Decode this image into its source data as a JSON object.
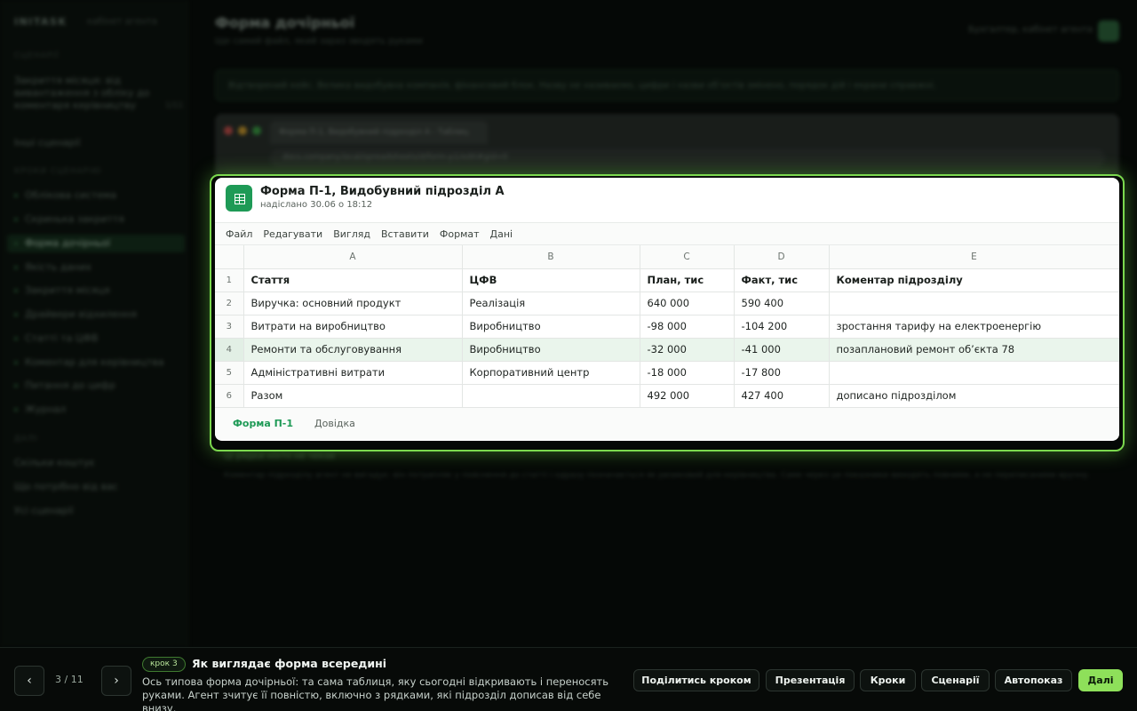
{
  "app": {
    "logo": "INITASK",
    "logo_sub": "кабінет агента",
    "page_title": "Форма дочірньої",
    "page_subtitle": "Ще самий файл, який зараз зводять руками",
    "top_right": "Бухгалтер, кабінет агента",
    "avatar": "Б",
    "banner": "Відтворений кейс. Велика видобувна компанія, фінансовий блок. Назву не називаємо, цифри і назви об’єктів змінено, порядок дій і екрани справжні.",
    "window_tab": "Форма П-1, Видобувний підрозділ А - Таблиц",
    "window_url": "docs.company.local/spreadsheets/d/form-p1/edit#gid=0",
    "caption_title": "Ці рядки ніхто не чекав",
    "caption_text": "Коментар підрозділу агент не вигадує: він потрапляє у пояснення до статті і одразу позначається як ризиковий для керівництва. Саме через це показники виходять повними, а не переписаними вручну."
  },
  "sidebar": {
    "section_1": "СЦЕНАРІЇ",
    "scenario_items": [
      {
        "label": "Закриття місяця: від вивантаження з обліку до коментаря керівництву",
        "badge": "1/11"
      },
      {
        "label": "Інші сценарії"
      }
    ],
    "section_2": "КРОКИ СЦЕНАРІЮ",
    "step_items": [
      {
        "label": "Облікова система"
      },
      {
        "label": "Скринька закриття"
      },
      {
        "label": "Форма дочірньої"
      },
      {
        "label": "Якість даних"
      },
      {
        "label": "Закриття місяця"
      },
      {
        "label": "Драйвери відхилення"
      },
      {
        "label": "Статті та ЦФВ"
      },
      {
        "label": "Коментар для керівництва"
      },
      {
        "label": "Питання до цифр"
      },
      {
        "label": "Журнал"
      }
    ],
    "section_3": "ДАЛІ",
    "next_items": [
      {
        "label": "Скільки коштує"
      },
      {
        "label": "Що потрібно від вас"
      },
      {
        "label": "Усі сценарії"
      }
    ]
  },
  "document": {
    "title": "Форма П-1, Видобувний підрозділ А",
    "meta": "надіслано 30.06 о 18:12",
    "menu": [
      "Файл",
      "Редагувати",
      "Вигляд",
      "Вставити",
      "Формат",
      "Дані"
    ],
    "columns": [
      "A",
      "B",
      "C",
      "D",
      "E"
    ],
    "rows": [
      {
        "n": "1",
        "cells": [
          "Стаття",
          "ЦФВ",
          "План, тис",
          "Факт, тис",
          "Коментар підрозділу"
        ]
      },
      {
        "n": "2",
        "cells": [
          "Виручка: основний продукт",
          "Реалізація",
          "640 000",
          "590 400",
          ""
        ]
      },
      {
        "n": "3",
        "cells": [
          "Витрати на виробництво",
          "Виробництво",
          "-98 000",
          "-104 200",
          "зростання тарифу на електроенергію"
        ]
      },
      {
        "n": "4",
        "cells": [
          "Ремонти та обслуговування",
          "Виробництво",
          "-32 000",
          "-41 000",
          "позаплановий ремонт об’єкта 78"
        ]
      },
      {
        "n": "5",
        "cells": [
          "Адміністративні витрати",
          "Корпоративний центр",
          "-18 000",
          "-17 800",
          ""
        ]
      },
      {
        "n": "6",
        "cells": [
          "Разом",
          "",
          "492 000",
          "427 400",
          "дописано підрозділом"
        ]
      }
    ],
    "tabs": [
      "Форма П-1",
      "Довідка"
    ]
  },
  "bottom": {
    "prev": "‹",
    "next": "›",
    "counter": "3 / 11",
    "step_badge": "крок 3",
    "step_title": "Як виглядає форма всередині",
    "step_desc": "Ось типова форма дочірньої: та сама таблиця, яку сьогодні відкривають і переносять руками. Агент зчитує її повністю, включно з рядками, які підрозділ дописав від себе внизу.",
    "buttons": [
      "Поділитись кроком",
      "Презентація",
      "Кроки",
      "Сценарії",
      "Автопоказ"
    ],
    "primary": "Далі"
  },
  "colors": {
    "accent": "#8ee05a",
    "sheet_green": "#1e9a56",
    "highlight_row": "#eaf5ec"
  }
}
